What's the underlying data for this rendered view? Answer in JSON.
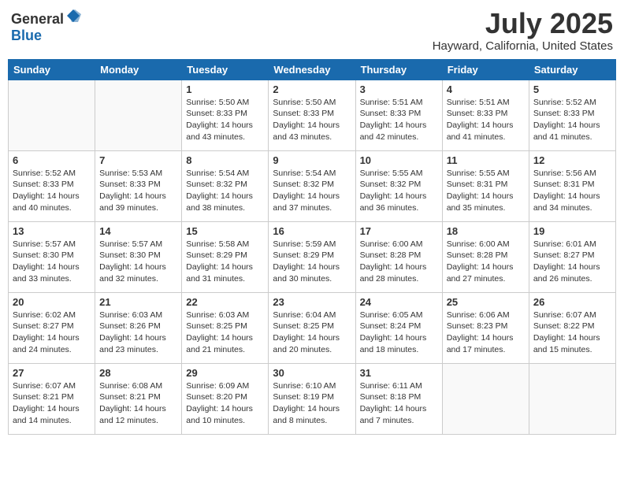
{
  "header": {
    "logo_general": "General",
    "logo_blue": "Blue",
    "month": "July 2025",
    "location": "Hayward, California, United States"
  },
  "days_of_week": [
    "Sunday",
    "Monday",
    "Tuesday",
    "Wednesday",
    "Thursday",
    "Friday",
    "Saturday"
  ],
  "weeks": [
    [
      {
        "day": "",
        "info": ""
      },
      {
        "day": "",
        "info": ""
      },
      {
        "day": "1",
        "info": "Sunrise: 5:50 AM\nSunset: 8:33 PM\nDaylight: 14 hours and 43 minutes."
      },
      {
        "day": "2",
        "info": "Sunrise: 5:50 AM\nSunset: 8:33 PM\nDaylight: 14 hours and 43 minutes."
      },
      {
        "day": "3",
        "info": "Sunrise: 5:51 AM\nSunset: 8:33 PM\nDaylight: 14 hours and 42 minutes."
      },
      {
        "day": "4",
        "info": "Sunrise: 5:51 AM\nSunset: 8:33 PM\nDaylight: 14 hours and 41 minutes."
      },
      {
        "day": "5",
        "info": "Sunrise: 5:52 AM\nSunset: 8:33 PM\nDaylight: 14 hours and 41 minutes."
      }
    ],
    [
      {
        "day": "6",
        "info": "Sunrise: 5:52 AM\nSunset: 8:33 PM\nDaylight: 14 hours and 40 minutes."
      },
      {
        "day": "7",
        "info": "Sunrise: 5:53 AM\nSunset: 8:33 PM\nDaylight: 14 hours and 39 minutes."
      },
      {
        "day": "8",
        "info": "Sunrise: 5:54 AM\nSunset: 8:32 PM\nDaylight: 14 hours and 38 minutes."
      },
      {
        "day": "9",
        "info": "Sunrise: 5:54 AM\nSunset: 8:32 PM\nDaylight: 14 hours and 37 minutes."
      },
      {
        "day": "10",
        "info": "Sunrise: 5:55 AM\nSunset: 8:32 PM\nDaylight: 14 hours and 36 minutes."
      },
      {
        "day": "11",
        "info": "Sunrise: 5:55 AM\nSunset: 8:31 PM\nDaylight: 14 hours and 35 minutes."
      },
      {
        "day": "12",
        "info": "Sunrise: 5:56 AM\nSunset: 8:31 PM\nDaylight: 14 hours and 34 minutes."
      }
    ],
    [
      {
        "day": "13",
        "info": "Sunrise: 5:57 AM\nSunset: 8:30 PM\nDaylight: 14 hours and 33 minutes."
      },
      {
        "day": "14",
        "info": "Sunrise: 5:57 AM\nSunset: 8:30 PM\nDaylight: 14 hours and 32 minutes."
      },
      {
        "day": "15",
        "info": "Sunrise: 5:58 AM\nSunset: 8:29 PM\nDaylight: 14 hours and 31 minutes."
      },
      {
        "day": "16",
        "info": "Sunrise: 5:59 AM\nSunset: 8:29 PM\nDaylight: 14 hours and 30 minutes."
      },
      {
        "day": "17",
        "info": "Sunrise: 6:00 AM\nSunset: 8:28 PM\nDaylight: 14 hours and 28 minutes."
      },
      {
        "day": "18",
        "info": "Sunrise: 6:00 AM\nSunset: 8:28 PM\nDaylight: 14 hours and 27 minutes."
      },
      {
        "day": "19",
        "info": "Sunrise: 6:01 AM\nSunset: 8:27 PM\nDaylight: 14 hours and 26 minutes."
      }
    ],
    [
      {
        "day": "20",
        "info": "Sunrise: 6:02 AM\nSunset: 8:27 PM\nDaylight: 14 hours and 24 minutes."
      },
      {
        "day": "21",
        "info": "Sunrise: 6:03 AM\nSunset: 8:26 PM\nDaylight: 14 hours and 23 minutes."
      },
      {
        "day": "22",
        "info": "Sunrise: 6:03 AM\nSunset: 8:25 PM\nDaylight: 14 hours and 21 minutes."
      },
      {
        "day": "23",
        "info": "Sunrise: 6:04 AM\nSunset: 8:25 PM\nDaylight: 14 hours and 20 minutes."
      },
      {
        "day": "24",
        "info": "Sunrise: 6:05 AM\nSunset: 8:24 PM\nDaylight: 14 hours and 18 minutes."
      },
      {
        "day": "25",
        "info": "Sunrise: 6:06 AM\nSunset: 8:23 PM\nDaylight: 14 hours and 17 minutes."
      },
      {
        "day": "26",
        "info": "Sunrise: 6:07 AM\nSunset: 8:22 PM\nDaylight: 14 hours and 15 minutes."
      }
    ],
    [
      {
        "day": "27",
        "info": "Sunrise: 6:07 AM\nSunset: 8:21 PM\nDaylight: 14 hours and 14 minutes."
      },
      {
        "day": "28",
        "info": "Sunrise: 6:08 AM\nSunset: 8:21 PM\nDaylight: 14 hours and 12 minutes."
      },
      {
        "day": "29",
        "info": "Sunrise: 6:09 AM\nSunset: 8:20 PM\nDaylight: 14 hours and 10 minutes."
      },
      {
        "day": "30",
        "info": "Sunrise: 6:10 AM\nSunset: 8:19 PM\nDaylight: 14 hours and 8 minutes."
      },
      {
        "day": "31",
        "info": "Sunrise: 6:11 AM\nSunset: 8:18 PM\nDaylight: 14 hours and 7 minutes."
      },
      {
        "day": "",
        "info": ""
      },
      {
        "day": "",
        "info": ""
      }
    ]
  ]
}
